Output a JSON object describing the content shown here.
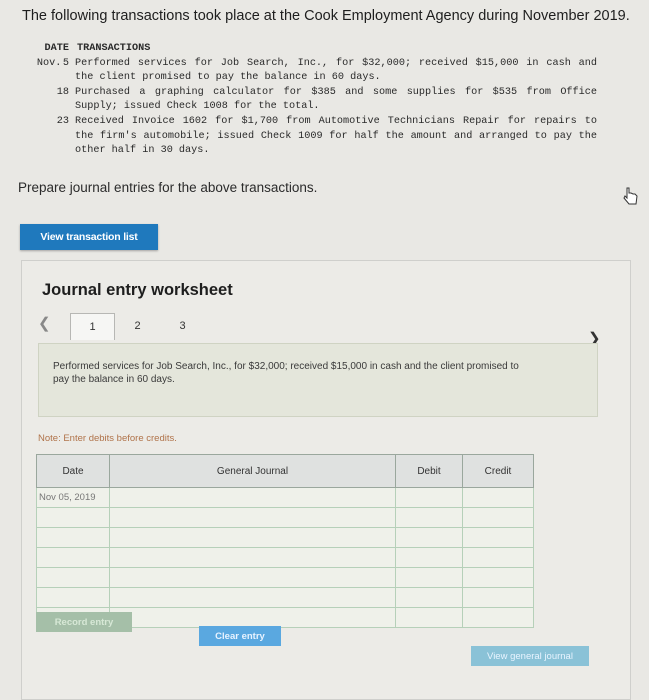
{
  "title": "The following transactions took place at the Cook Employment Agency during November 2019.",
  "transactions": {
    "header_date": "DATE",
    "header_tx": "TRANSACTIONS",
    "items": [
      {
        "month": "Nov.",
        "day": "5",
        "text": "Performed services for Job Search, Inc., for $32,000; received $15,000 in cash and the client promised to pay the balance in 60 days."
      },
      {
        "month": "",
        "day": "18",
        "text": "Purchased a graphing calculator for $385 and some supplies for $535 from Office Supply; issued Check 1008 for the total."
      },
      {
        "month": "",
        "day": "23",
        "text": "Received Invoice 1602 for $1,700 from Automotive Technicians Repair for repairs to the firm's automobile; issued Check 1009 for half the amount and arranged to pay the other half in 30 days."
      }
    ]
  },
  "prompt": "Prepare journal entries for the above transactions.",
  "view_transaction_list": "View transaction list",
  "worksheet": {
    "title": "Journal entry worksheet",
    "tabs": [
      "1",
      "2",
      "3"
    ],
    "description": "Performed services for Job Search, Inc., for $32,000; received $15,000 in cash and the client promised to pay the balance in 60 days.",
    "note": "Note: Enter debits before credits.",
    "columns": [
      "Date",
      "General Journal",
      "Debit",
      "Credit"
    ],
    "first_date": "Nov 05, 2019",
    "record_entry": "Record entry",
    "clear_entry": "Clear entry",
    "view_general_journal": "View general journal"
  }
}
